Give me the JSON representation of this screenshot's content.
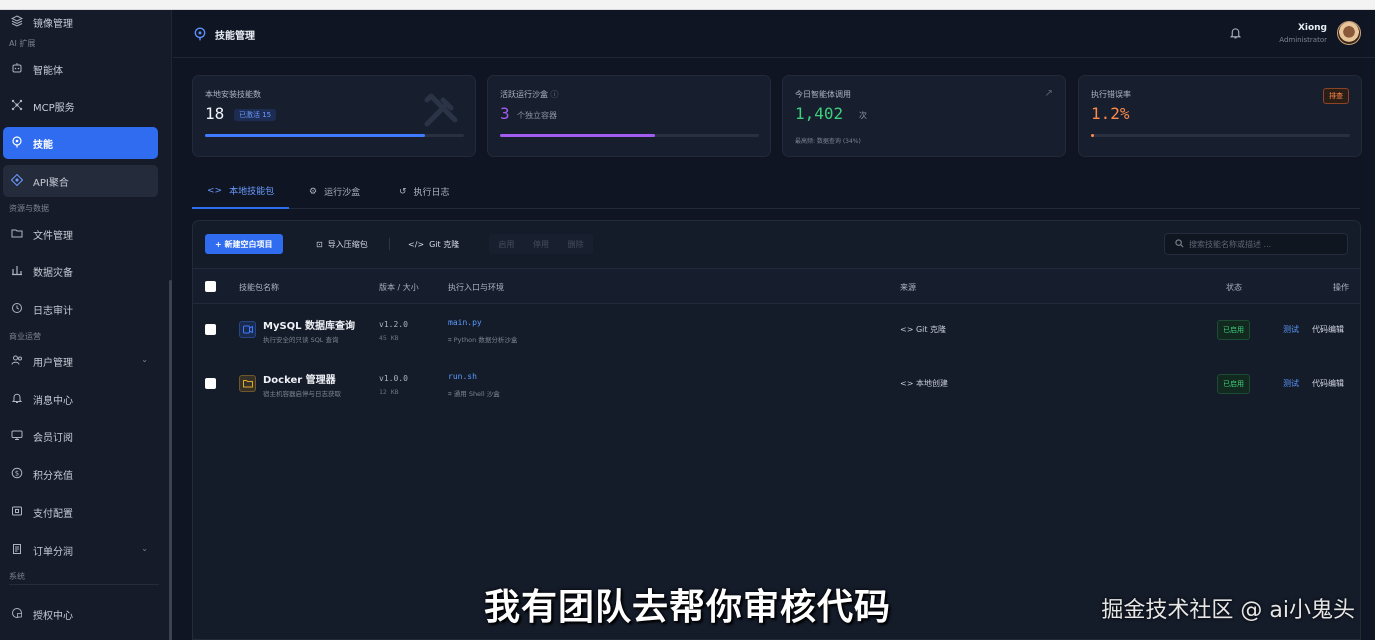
{
  "sidebar": {
    "items": [
      {
        "label": "镜像管理",
        "icon": "layers-icon"
      },
      {
        "label": "智能体",
        "icon": "robot-icon"
      },
      {
        "label": "MCP服务",
        "icon": "nodes-icon"
      },
      {
        "label": "技能",
        "icon": "skill-icon"
      },
      {
        "label": "API聚合",
        "icon": "api-icon"
      },
      {
        "label": "文件管理",
        "icon": "folder-icon"
      },
      {
        "label": "数据灾备",
        "icon": "backup-icon"
      },
      {
        "label": "日志审计",
        "icon": "history-icon"
      },
      {
        "label": "用户管理",
        "icon": "users-icon"
      },
      {
        "label": "消息中心",
        "icon": "bell-icon"
      },
      {
        "label": "会员订阅",
        "icon": "monitor-icon"
      },
      {
        "label": "积分充值",
        "icon": "coin-icon"
      },
      {
        "label": "支付配置",
        "icon": "wallet-icon"
      },
      {
        "label": "订单分润",
        "icon": "receipt-icon"
      },
      {
        "label": "授权中心",
        "icon": "license-icon"
      }
    ],
    "sections": [
      "AI 扩展",
      "资源与数据",
      "商业运营",
      "系统"
    ]
  },
  "header": {
    "title": "技能管理",
    "user_name": "Xiong",
    "user_role": "Administrator"
  },
  "stats": [
    {
      "label": "本地安装技能数",
      "value": "18",
      "badge": "已激活 15",
      "progress": 0.85
    },
    {
      "label": "活跃运行沙盒",
      "value": "3",
      "unit": "个独立容器",
      "progress": 0.6
    },
    {
      "label": "今日智能体调用",
      "value": "1,402",
      "unit": "次",
      "sub": "最高频: 数据查询 (34%)"
    },
    {
      "label": "执行错误率",
      "value": "1.2%",
      "tag": "排查",
      "progress": 0.012
    }
  ],
  "tabs": [
    {
      "label": "本地技能包",
      "icon": "code-icon"
    },
    {
      "label": "运行沙盒",
      "icon": "cube-icon"
    },
    {
      "label": "执行日志",
      "icon": "history-icon"
    }
  ],
  "toolbar": {
    "new_label": "+ 新建空白项目",
    "import_label": "导入压缩包",
    "git_label": "Git 克隆",
    "disabled": [
      "启用",
      "停用",
      "删除"
    ],
    "search_placeholder": "搜索技能名称或描述 ..."
  },
  "table": {
    "headers": [
      "技能包名称",
      "版本 / 大小",
      "执行入口与环境",
      "来源",
      "状态",
      "操作"
    ],
    "rows": [
      {
        "name": "MySQL 数据库查询",
        "desc": "执行安全的只读 SQL 查询",
        "version": "v1.2.0",
        "size": "45 KB",
        "entry": "main.py",
        "env": "Python 数据分析沙盒",
        "source": "Git 克隆",
        "status": "已启用",
        "action_test": "测试",
        "action_edit": "代码编辑",
        "icon_color": "#3f7bff"
      },
      {
        "name": "Docker 管理器",
        "desc": "宿主机容器启停与日志获取",
        "version": "v1.0.0",
        "size": "12 KB",
        "entry": "run.sh",
        "env": "通用 Shell 沙盒",
        "source": "本地创建",
        "status": "已启用",
        "action_test": "测试",
        "action_edit": "代码编辑",
        "icon_color": "#e0a626"
      }
    ]
  },
  "overlay": {
    "subtitle": "我有团队去帮你审核代码",
    "watermark": "掘金技术社区 @ ai小鬼头"
  },
  "colors": {
    "accent": "#2f6cf0",
    "background": "#0f1522",
    "success": "#3ecf7c",
    "warning": "#ff8a4a",
    "purple": "#a25cf0"
  }
}
